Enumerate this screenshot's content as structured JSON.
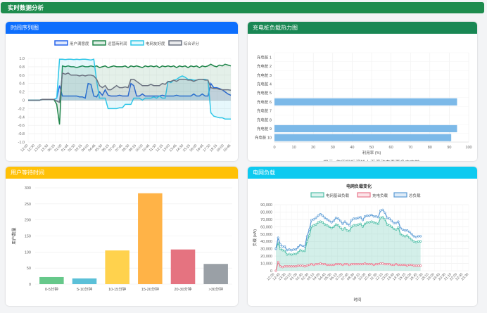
{
  "header": {
    "title": "实时数据分析"
  },
  "panels": {
    "timeseries": {
      "title": "时间序列图",
      "color": "#0d6efd"
    },
    "heatmap": {
      "title": "充电桩负载热力图",
      "color": "#198754",
      "hint": "提示: 使用鼠标滚轮上下滚动查看更多充电桩"
    },
    "wait": {
      "title": "用户等待时间",
      "color": "#ffc107"
    },
    "grid": {
      "title": "电网负载",
      "color": "#0dcaf0"
    }
  },
  "chart_data": [
    {
      "type": "line",
      "x": [
        "12:00",
        "12:30",
        "13:00",
        "13:30",
        "00:15",
        "01:00",
        "01:45",
        "02:30",
        "03:15",
        "04:00",
        "04:45",
        "05:30",
        "06:15",
        "07:00",
        "07:45",
        "08:30",
        "09:15",
        "10:00",
        "10:45",
        "11:30",
        "12:15",
        "13:00",
        "13:45",
        "14:30",
        "15:15",
        "16:00",
        "16:45",
        "17:30",
        "18:15",
        "19:00",
        "19:45"
      ],
      "ylim": [
        -1.0,
        1.0
      ],
      "yticks": [
        "1.0",
        "0.8",
        "0.6",
        "0.4",
        "0.2",
        "0",
        "-0.2",
        "-0.4",
        "-0.6",
        "-0.8",
        "-1.0"
      ],
      "series": [
        {
          "name": "用户满意度",
          "color": "#2563eb",
          "values": [
            0,
            0,
            0,
            0,
            0,
            0.02,
            0.02,
            0.02,
            0.02,
            0.02,
            0.05,
            0.35,
            0.1,
            0.1,
            0.1,
            0.1,
            0.1,
            0.1,
            0.08,
            0.08,
            0.05,
            0.4,
            0.38,
            0.1,
            0.08,
            0.2,
            0.12,
            0.25,
            0.12,
            0.1,
            0.1,
            0.1,
            0.12,
            0.1,
            0.1,
            0.1,
            0.4,
            0.35,
            0.1,
            0.1,
            0.15,
            0.1,
            0.1,
            0.1,
            0.1,
            0.1,
            0.1,
            0.12,
            0.1,
            0.1,
            0.1,
            0.1,
            0.12,
            0.1,
            0.1,
            0.1,
            0.1,
            0.1,
            0.15,
            0.1,
            0.1,
            0.15,
            0.1,
            0.1,
            0.4,
            0.3,
            0.3,
            0.28,
            0.25,
            0.2,
            0.15,
            0.12
          ]
        },
        {
          "name": "运营商利润",
          "color": "#1e8449",
          "values": [
            0,
            0,
            0,
            0,
            0,
            0.02,
            0.02,
            0.02,
            0.02,
            0.02,
            -0.1,
            -0.58,
            0.82,
            0.8,
            0.82,
            0.8,
            0.8,
            0.78,
            0.8,
            0.82,
            0.8,
            0.8,
            0.82,
            0.8,
            0.82,
            0.78,
            0.8,
            0.82,
            0.78,
            0.8,
            0.82,
            0.8,
            0.8,
            0.8,
            0.82,
            0.78,
            0.82,
            0.8,
            0.82,
            0.8,
            0.78,
            0.82,
            0.8,
            0.82,
            0.8,
            0.82,
            0.78,
            0.82,
            0.8,
            0.82,
            0.8,
            0.82,
            0.78,
            0.82,
            0.8,
            0.82,
            0.78,
            0.82,
            0.8,
            0.82,
            0.78,
            0.82,
            0.8,
            0.82,
            0.86,
            0.82,
            0.8,
            0.84,
            0.82,
            0.86,
            0.84,
            0.82
          ]
        },
        {
          "name": "电网友好度",
          "color": "#2ec7e8",
          "values": [
            0,
            0,
            0,
            0,
            0,
            0.02,
            0.02,
            0.02,
            0.02,
            0.02,
            0.05,
            0.98,
            0.98,
            0.97,
            0.98,
            0.98,
            0.97,
            0.98,
            0.97,
            0.98,
            0.98,
            0.97,
            0.96,
            0.98,
            0.45,
            0.05,
            0.05,
            0.05,
            -0.2,
            -0.2,
            -0.2,
            -0.2,
            -0.18,
            -0.18,
            -0.1,
            -0.1,
            -0.1,
            0.05,
            0.05,
            0.05,
            0.0,
            0.05,
            0.05,
            0.05,
            0.08,
            0.05,
            0.1,
            0.05,
            0.05,
            0.45,
            0.42,
            0.48,
            0.5,
            0.55,
            0.58,
            0.55,
            0.5,
            0.5,
            0.48,
            0.48,
            0.5,
            0.5,
            0.5,
            0.48,
            -0.3,
            -0.38,
            -0.4,
            -0.42,
            -0.42,
            -0.45,
            -0.45,
            -0.45
          ]
        },
        {
          "name": "综合评分",
          "color": "#6b7280",
          "values": [
            0,
            0,
            0,
            0,
            0,
            0.02,
            0.02,
            0.02,
            0.02,
            0.02,
            -0.02,
            -0.05,
            0.65,
            0.62,
            0.65,
            0.6,
            0.6,
            0.6,
            0.58,
            0.6,
            0.58,
            0.6,
            0.6,
            0.58,
            0.5,
            0.35,
            0.3,
            0.35,
            0.25,
            0.25,
            0.3,
            0.35,
            0.3,
            0.3,
            0.32,
            0.3,
            0.5,
            0.5,
            0.45,
            0.4,
            0.35,
            0.35,
            0.35,
            0.38,
            0.35,
            0.35,
            0.35,
            0.4,
            0.38,
            0.45,
            0.45,
            0.48,
            0.45,
            0.5,
            0.5,
            0.5,
            0.48,
            0.48,
            0.45,
            0.48,
            0.5,
            0.5,
            0.48,
            0.48,
            0.3,
            0.28,
            0.28,
            0.26,
            0.25,
            0.25,
            0.25,
            0.24
          ]
        }
      ]
    },
    {
      "type": "bar",
      "orientation": "horizontal",
      "categories": [
        "充电桩 1",
        "充电桩 2",
        "充电桩 3",
        "充电桩 4",
        "充电桩 5",
        "充电桩 6",
        "充电桩 7",
        "充电桩 8",
        "充电桩 9",
        "充电桩 10"
      ],
      "values": [
        0,
        0,
        0,
        0,
        0,
        94,
        0,
        0,
        94,
        91
      ],
      "xlabel": "利用率 (%)",
      "xlim": [
        0,
        100
      ],
      "xticks": [
        "0",
        "10",
        "20",
        "30",
        "40",
        "50",
        "60",
        "70",
        "80",
        "90",
        "100"
      ],
      "color": "#7cb9e8"
    },
    {
      "type": "bar",
      "categories": [
        "0-5分钟",
        "5-10分钟",
        "10-15分钟",
        "15-20分钟",
        "20-30分钟",
        ">30分钟"
      ],
      "values": [
        22,
        18,
        105,
        283,
        108,
        63
      ],
      "colors": [
        "#66c88a",
        "#5bc0d8",
        "#ffd24d",
        "#ffb347",
        "#e57380",
        "#9aa0a6"
      ],
      "ylabel": "用户数量",
      "ylim": [
        0,
        300
      ],
      "yticks": [
        "0",
        "50",
        "100",
        "150",
        "200",
        "250",
        "300"
      ]
    },
    {
      "type": "line",
      "title": "电网负载变化",
      "xlabel": "时间",
      "ylabel": "负载 (kW)",
      "ylim": [
        0,
        90000
      ],
      "yticks": [
        "0",
        "10,000",
        "20,000",
        "30,000",
        "40,000",
        "50,000",
        "60,000",
        "70,000",
        "80,000",
        "90,000"
      ],
      "x": [
        "12:00",
        "12:45",
        "13:30",
        "00:15",
        "01:00",
        "01:45",
        "02:30",
        "03:15",
        "04:00",
        "04:45",
        "05:30",
        "06:15",
        "07:00",
        "07:45",
        "08:30",
        "09:15",
        "10:00",
        "10:45",
        "11:30",
        "12:15",
        "13:00",
        "13:45",
        "14:30",
        "15:15",
        "16:00",
        "16:45",
        "17:30",
        "18:15",
        "19:00",
        "19:45",
        "20:30",
        "21:15",
        "22:00",
        "22:45",
        "23:30"
      ],
      "series": [
        {
          "name": "电网基础负载",
          "color": "#4fbfa8",
          "values": [
            30000,
            38000,
            30000,
            28000,
            27000,
            22000,
            23000,
            22000,
            23000,
            23000,
            25000,
            28000,
            27000,
            27000,
            40000,
            48000,
            60000,
            62000,
            63000,
            66000,
            67000,
            66000,
            63000,
            62000,
            60000,
            58000,
            60000,
            63000,
            62000,
            59000,
            56000,
            58000,
            55000,
            54000,
            60000,
            62000,
            62000,
            63000,
            64000,
            60000,
            64000,
            66000,
            66000,
            67000,
            66000,
            65000,
            64000,
            72000,
            73000,
            70000,
            63000,
            62000,
            60000,
            57000,
            56000,
            59000,
            50000,
            48000,
            47000,
            48000,
            45000,
            42000,
            40000,
            39000,
            40000,
            40000
          ]
        },
        {
          "name": "充电负载",
          "color": "#e9768c",
          "values": [
            0,
            12000,
            6000,
            5000,
            6000,
            6000,
            6000,
            6000,
            6000,
            6000,
            7000,
            7000,
            7000,
            6000,
            7000,
            8000,
            9000,
            8000,
            9000,
            9000,
            10000,
            9000,
            9000,
            8000,
            8000,
            8000,
            8000,
            9000,
            9000,
            9000,
            8000,
            9000,
            9000,
            8000,
            9000,
            9000,
            9000,
            9000,
            9000,
            9000,
            10000,
            9000,
            9000,
            9000,
            8000,
            9000,
            9000,
            10000,
            10000,
            9000,
            9000,
            9000,
            8000,
            8000,
            9000,
            8000,
            8000,
            8000,
            8000,
            7000,
            8000,
            8000,
            7000,
            7000,
            7000,
            7000
          ]
        },
        {
          "name": "总负载",
          "color": "#5b9bd5",
          "values": [
            30000,
            45000,
            36000,
            33000,
            33000,
            28000,
            29000,
            28000,
            29000,
            29000,
            32000,
            35000,
            34000,
            33000,
            47000,
            56000,
            69000,
            70000,
            72000,
            75000,
            77000,
            75000,
            72000,
            70000,
            68000,
            66000,
            68000,
            72000,
            71000,
            68000,
            64000,
            67000,
            64000,
            62000,
            69000,
            71000,
            71000,
            72000,
            73000,
            69000,
            74000,
            75000,
            75000,
            76000,
            74000,
            74000,
            73000,
            82000,
            83000,
            79000,
            72000,
            71000,
            68000,
            65000,
            65000,
            67000,
            58000,
            56000,
            55000,
            55000,
            53000,
            50000,
            47000,
            46000,
            47000,
            47000
          ]
        }
      ]
    }
  ]
}
